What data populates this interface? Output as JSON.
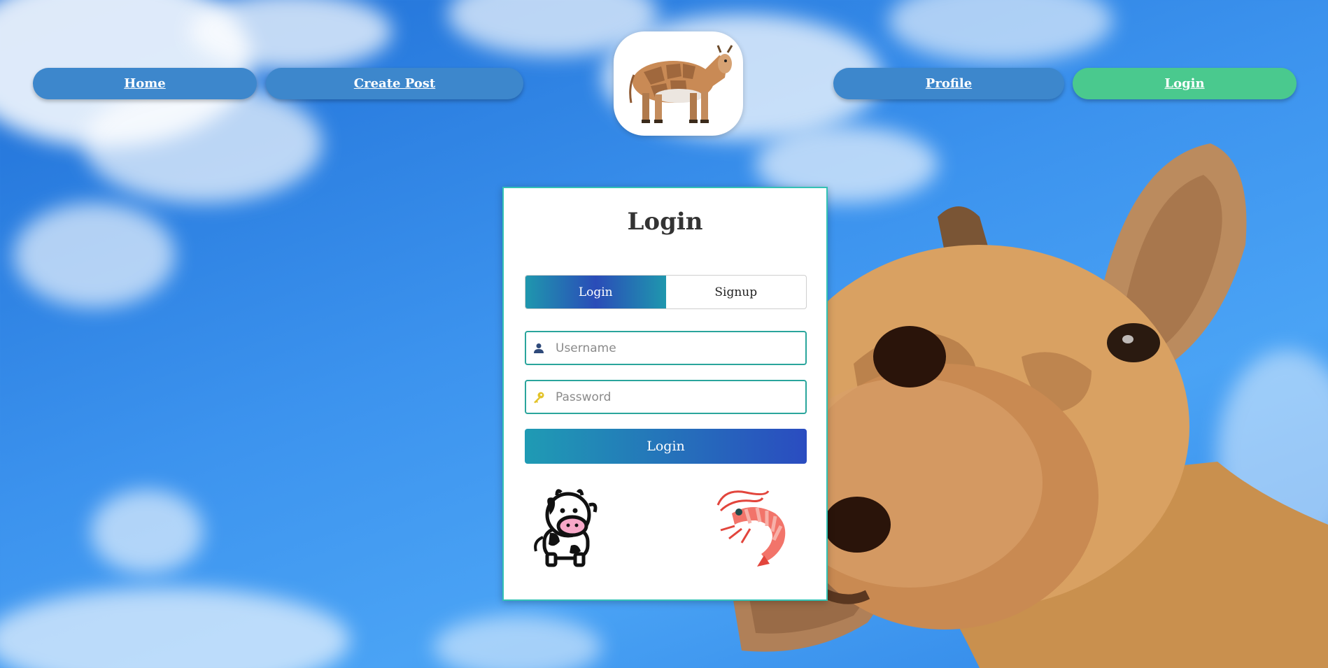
{
  "nav": {
    "home": "Home",
    "create_post": "Create Post",
    "profile": "Profile",
    "login": "Login",
    "active_color": "#4ac98e",
    "default_color": "#3d87cc"
  },
  "logo": {
    "icon": "cow-logo-icon"
  },
  "card": {
    "title": "Login",
    "tabs": [
      {
        "label": "Login",
        "active": true
      },
      {
        "label": "Signup",
        "active": false
      }
    ],
    "username": {
      "placeholder": "Username",
      "value": "",
      "icon": "user-icon"
    },
    "password": {
      "placeholder": "Password",
      "value": "",
      "icon": "key-icon"
    },
    "submit_label": "Login",
    "decorations": [
      "cow-cartoon-icon",
      "shrimp-icon"
    ]
  },
  "background": {
    "icons": [
      "giraffe-image",
      "sky-clouds"
    ]
  }
}
